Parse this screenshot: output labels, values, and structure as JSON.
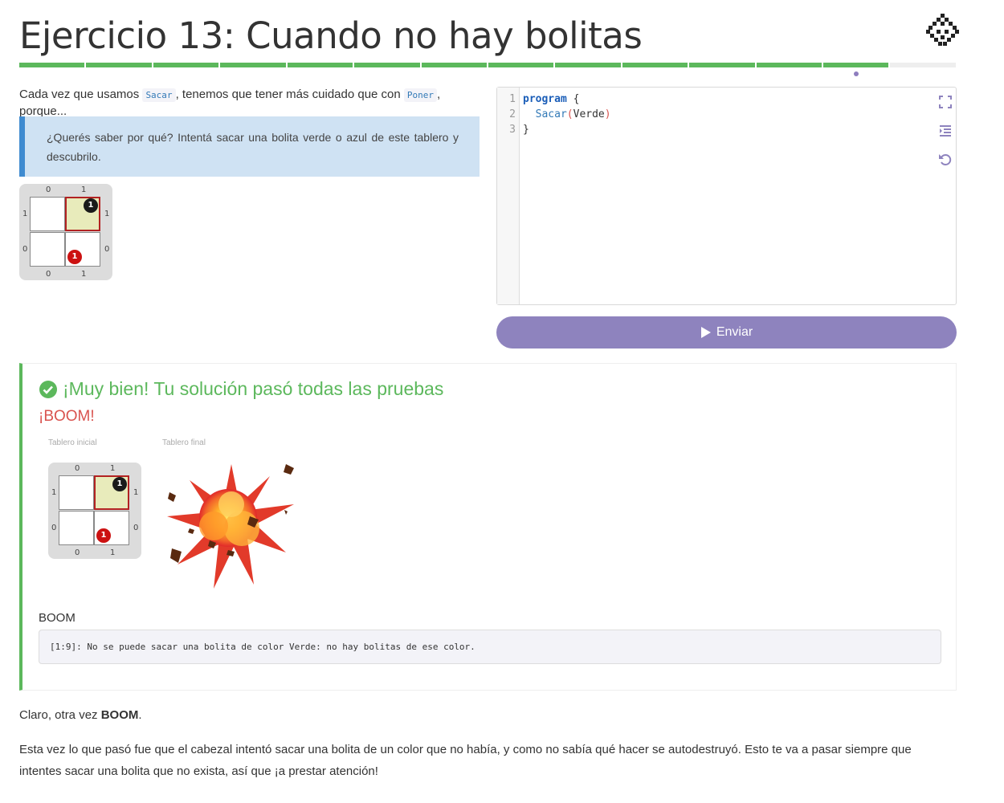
{
  "header": {
    "title": "Ejercicio 13: Cuando no hay bolitas",
    "progress": {
      "total_segments": 14,
      "completed_segments": 13,
      "current": 13
    }
  },
  "intro": {
    "before": "Cada vez que usamos",
    "code1": "Sacar",
    "middle": ", tenemos que tener más cuidado que con",
    "code2": "Poner",
    "after": ", porque..."
  },
  "callout": {
    "text": "¿Querés saber por qué? Intentá sacar una bolita verde o azul de este tablero y descubrilo."
  },
  "board": {
    "col_labels": [
      "0",
      "1"
    ],
    "row_labels": [
      "1",
      "0"
    ],
    "balls": [
      {
        "color": "black",
        "count": "1",
        "col": 1,
        "row": 1
      },
      {
        "color": "red",
        "count": "1",
        "col": 1,
        "row": 0
      }
    ],
    "head": {
      "col": 1,
      "row": 1
    }
  },
  "editor": {
    "line_numbers": [
      "1",
      "2",
      "3"
    ],
    "keyword": "program",
    "brace_open": " {",
    "indent": "  ",
    "function": "Sacar",
    "paren_open": "(",
    "argument": "Verde",
    "paren_close": ")",
    "brace_close": "}",
    "tools": [
      "fullscreen-icon",
      "indent-icon",
      "reset-icon"
    ]
  },
  "submit": {
    "label": "Enviar",
    "color": "#8e83be"
  },
  "result": {
    "title": "¡Muy bien! Tu solución pasó todas las pruebas",
    "subtitle": "¡BOOM!",
    "caption_initial": "Tablero inicial",
    "caption_final": "Tablero final",
    "boom_label": "BOOM",
    "error": "[1:9]: No se puede sacar una bolita de color Verde: no hay bolitas de ese color.",
    "success_color": "#5cb85c",
    "boom_color": "#d9534f"
  },
  "footer": {
    "para1_prefix": "Claro, otra vez ",
    "para1_bold": "BOOM",
    "para1_suffix": ".",
    "para2": "Esta vez lo que pasó fue que el cabezal intentó sacar una bolita de un color que no había, y como no sabía qué hacer se autodestruyó. Esto te va a pasar siempre que intentes sacar una bolita que no exista, así que ¡a prestar atención!"
  }
}
